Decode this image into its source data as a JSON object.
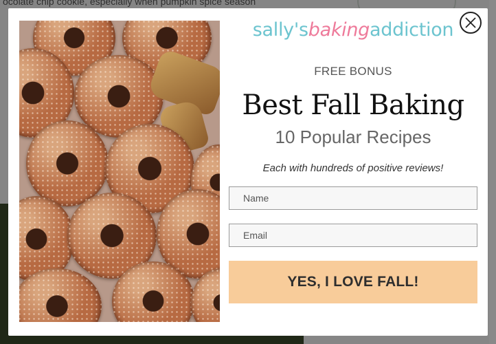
{
  "background": {
    "top_text": "ocolate chip cookie, especially when pumpkin spice season"
  },
  "modal": {
    "brand": {
      "part1": "sally's",
      "part2": "baking",
      "part3": "addiction"
    },
    "kicker": "FREE BONUS",
    "headline": "Best Fall Baking",
    "subhead": "10 Popular Recipes",
    "tagline": "Each with hundreds of positive reviews!",
    "form": {
      "name_placeholder": "Name",
      "email_placeholder": "Email",
      "submit_label": "YES, I LOVE FALL!"
    }
  },
  "colors": {
    "brand_teal": "#6cc4cf",
    "brand_pink": "#ee7a9a",
    "cta_background": "#f8cc9a"
  },
  "icons": {
    "close": "close-icon",
    "photo": "donuts-photo"
  }
}
